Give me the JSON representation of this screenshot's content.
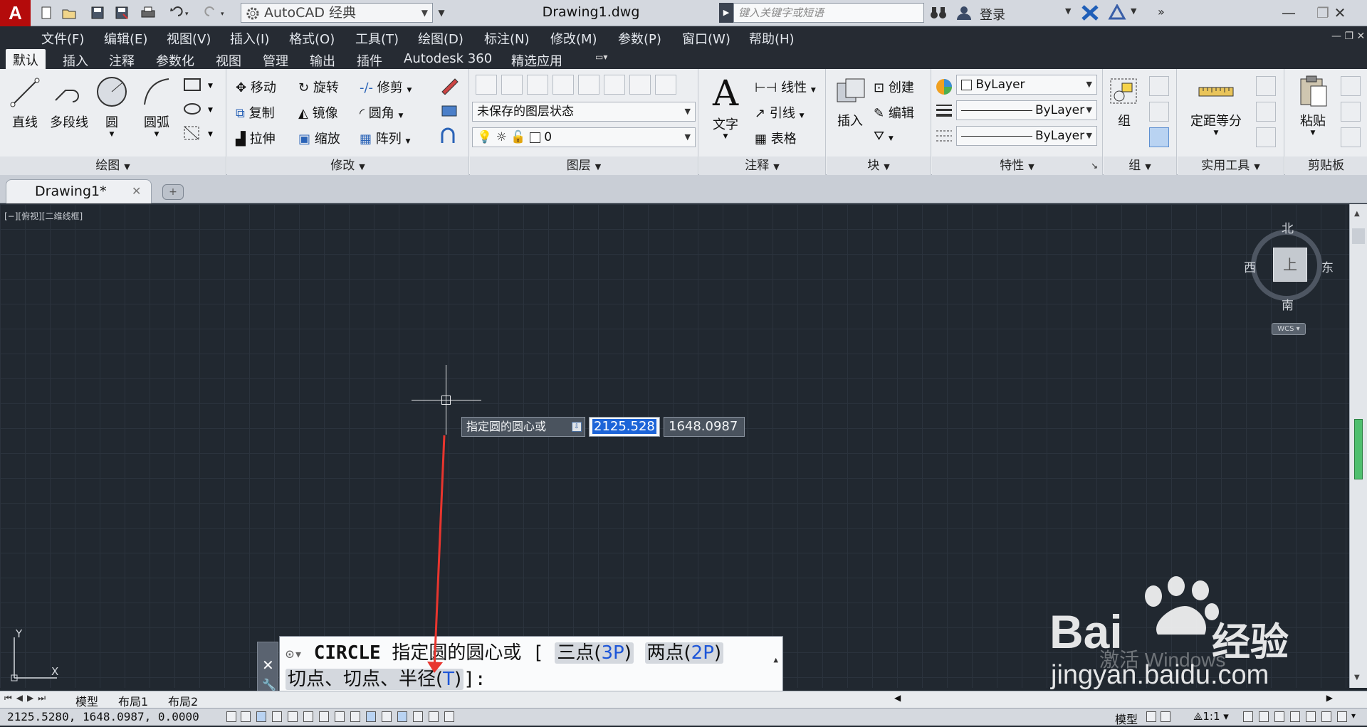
{
  "titlebar": {
    "logo": "A",
    "workspace": "AutoCAD 经典",
    "document_title": "Drawing1.dwg",
    "search_placeholder": "键入关键字或短语",
    "login": "登录",
    "icons": [
      "new-icon",
      "open-icon",
      "save-icon",
      "saveas-icon",
      "print-icon",
      "undo-icon",
      "redo-icon"
    ]
  },
  "menubar": [
    "文件(F)",
    "编辑(E)",
    "视图(V)",
    "插入(I)",
    "格式(O)",
    "工具(T)",
    "绘图(D)",
    "标注(N)",
    "修改(M)",
    "参数(P)",
    "窗口(W)",
    "帮助(H)"
  ],
  "ribbon_tabs": [
    "默认",
    "插入",
    "注释",
    "参数化",
    "视图",
    "管理",
    "输出",
    "插件",
    "Autodesk 360",
    "精选应用"
  ],
  "active_tab": "默认",
  "ribbon": {
    "draw": {
      "title": "绘图",
      "line": "直线",
      "polyline": "多段线",
      "circle": "圆",
      "arc": "圆弧"
    },
    "modify": {
      "title": "修改",
      "move": "移动",
      "rotate": "旋转",
      "trim": "修剪",
      "copy": "复制",
      "mirror": "镜像",
      "fillet": "圆角",
      "stretch": "拉伸",
      "scale": "缩放",
      "array": "阵列"
    },
    "layers": {
      "title": "图层",
      "layer_state": "未保存的图层状态",
      "current_layer": "0"
    },
    "annotation": {
      "title": "注释",
      "text": "文字",
      "linear": "线性",
      "leader": "引线",
      "table": "表格"
    },
    "block": {
      "title": "块",
      "insert": "插入",
      "create": "创建",
      "edit": "编辑"
    },
    "properties": {
      "title": "特性",
      "color": "ByLayer",
      "linetype": "ByLayer",
      "lineweight": "ByLayer"
    },
    "group": {
      "title": "组",
      "group": "组"
    },
    "utilities": {
      "title": "实用工具",
      "measure": "定距等分"
    },
    "clipboard": {
      "title": "剪贴板",
      "paste": "粘贴"
    }
  },
  "doc_tab": "Drawing1*",
  "viewport_label": "[−][俯视][二维线框]",
  "viewcube": {
    "north": "北",
    "south": "南",
    "east": "东",
    "west": "西",
    "face": "上",
    "wcs": "WCS"
  },
  "dynamic_input": {
    "prompt": "指定圆的圆心或",
    "x": "2125.528",
    "y": "1648.0987"
  },
  "command": {
    "name": "CIRCLE",
    "prompt": "指定圆的圆心或",
    "open": "[",
    "opt1": "三点(",
    "opt1_kw": "3P",
    "opt1_end": ")",
    "opt2": "两点(",
    "opt2_kw": "2P",
    "opt2_end": ")",
    "opt3": "切点、切点、半径(",
    "opt3_kw": "T",
    "opt3_end": ")",
    "close": "]:"
  },
  "layout_tabs": [
    "模型",
    "布局1",
    "布局2"
  ],
  "status": {
    "coords": "2125.5280,  1648.0987,  0.0000",
    "model": "模型",
    "scale": "1:1"
  },
  "ucs": {
    "x": "X",
    "y": "Y"
  },
  "watermark": {
    "brand": "Bai",
    "brand2": "经验",
    "line1": "激活 Windows",
    "url": "jingyan.baidu.com"
  },
  "colors": {
    "canvas": "#212830",
    "accent": "#b40b0b",
    "selection": "#1c64d8",
    "arrow": "#e8352e"
  }
}
